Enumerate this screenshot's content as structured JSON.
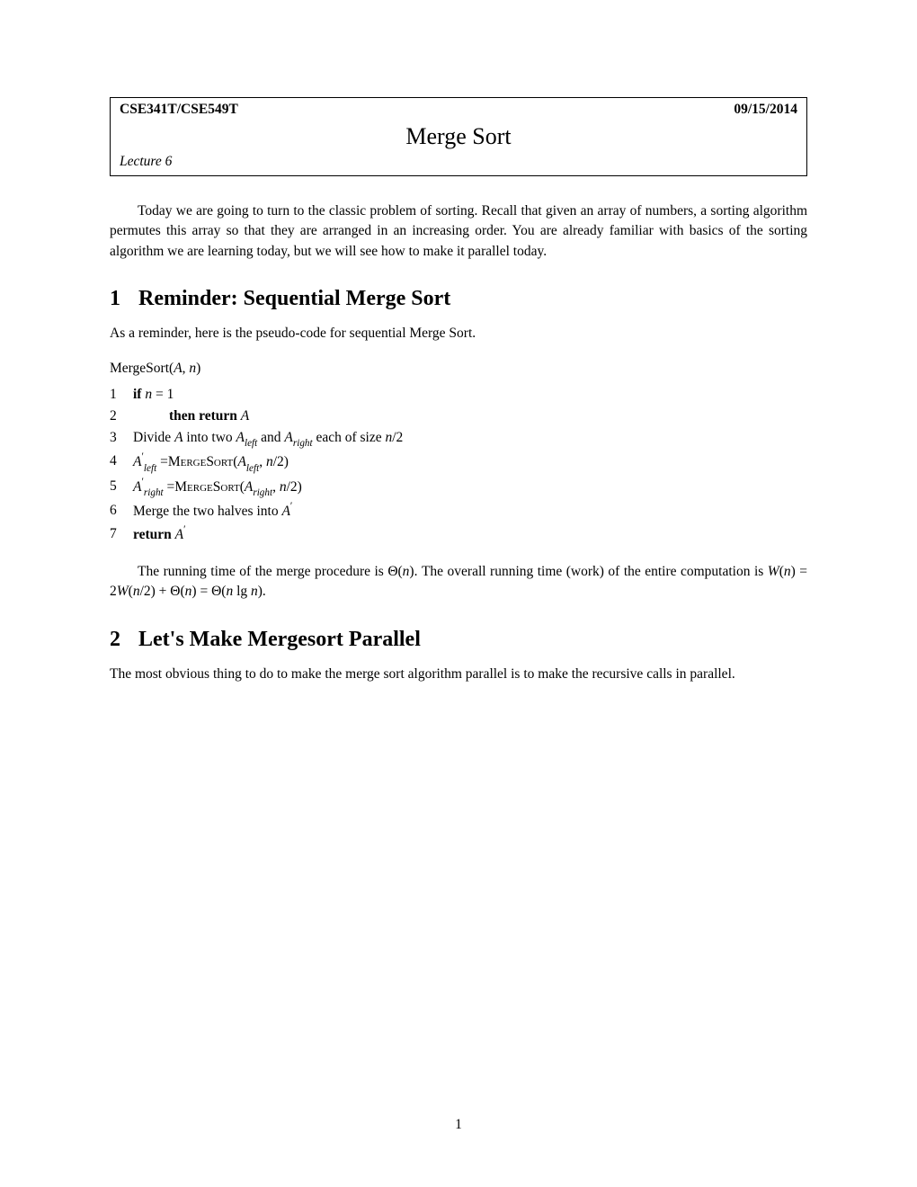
{
  "header": {
    "course": "CSE341T/CSE549T",
    "date": "09/15/2014",
    "title": "Merge Sort",
    "lecture": "Lecture 6"
  },
  "intro": "Today we are going to turn to the classic problem of sorting. Recall that given an array of numbers, a sorting algorithm permutes this array so that they are arranged in an increasing order. You are already familiar with basics of the sorting algorithm we are learning today, but we will see how to make it parallel today.",
  "section1": {
    "num": "1",
    "title": "Reminder: Sequential Merge Sort",
    "lead": "As a reminder, here is the pseudo-code for sequential Merge Sort."
  },
  "algo": {
    "name_prefix": "MergeSort",
    "lines": {
      "l1": {
        "n": "1",
        "kw_if": "if"
      },
      "l2": {
        "n": "2",
        "kw_then": "then return"
      },
      "l3": {
        "n": "3",
        "txt_a": "Divide ",
        "txt_b": " into two ",
        "txt_c": " and ",
        "txt_d": " each of size "
      },
      "l4": {
        "n": "4",
        "proc": "MergeSort"
      },
      "l5": {
        "n": "5",
        "proc": "MergeSort"
      },
      "l6": {
        "n": "6",
        "txt": "Merge the two halves into "
      },
      "l7": {
        "n": "7",
        "kw_return": "return"
      }
    }
  },
  "para2_a": "The running time of the merge procedure is ",
  "para2_b": ". The overall running time (work) of the entire computation is ",
  "section2": {
    "num": "2",
    "title": "Let's Make Mergesort Parallel",
    "body": "The most obvious thing to do to make the merge sort algorithm parallel is to make the recursive calls in parallel."
  },
  "pagenum": "1"
}
